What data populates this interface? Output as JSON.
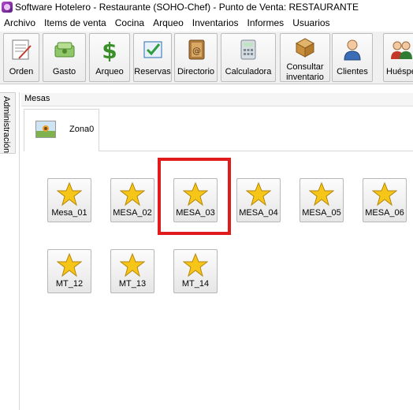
{
  "window": {
    "title": "Software  Hotelero - Restaurante (SOHO-Chef)  - Punto de Venta: RESTAURANTE"
  },
  "menu": [
    {
      "label": "Archivo"
    },
    {
      "label": "Items de venta"
    },
    {
      "label": "Cocina"
    },
    {
      "label": "Arqueo"
    },
    {
      "label": "Inventarios"
    },
    {
      "label": "Informes"
    },
    {
      "label": "Usuarios"
    }
  ],
  "toolbar": [
    {
      "label": "Orden",
      "icon": "order-pad-icon"
    },
    {
      "label": "Gasto",
      "icon": "money-icon"
    },
    {
      "label": "Arqueo",
      "icon": "dollar-icon"
    },
    {
      "label": "Reservas",
      "icon": "checklist-icon"
    },
    {
      "label": "Directorio",
      "icon": "address-book-icon"
    },
    {
      "label": "Calculadora",
      "icon": "calculator-icon"
    },
    {
      "label_line1": "Consultar",
      "label_line2": "inventario",
      "icon": "box-icon"
    },
    {
      "label": "Clientes",
      "icon": "person-icon"
    },
    {
      "label": "Huésped",
      "icon": "guests-icon"
    }
  ],
  "sidebar": {
    "label": "Administración"
  },
  "panel": {
    "header": "Mesas",
    "zone_tab": {
      "label": "Zona0"
    }
  },
  "tables": [
    {
      "label": "Mesa_01"
    },
    {
      "label": "MESA_02"
    },
    {
      "label": "MESA_03"
    },
    {
      "label": "MESA_04"
    },
    {
      "label": "MESA_05"
    },
    {
      "label": "MESA_06"
    },
    {
      "label": "MT_12"
    },
    {
      "label": "MT_13"
    },
    {
      "label": "MT_14"
    }
  ],
  "colors": {
    "highlight": "#e01b1b",
    "star": "#f5c518"
  }
}
